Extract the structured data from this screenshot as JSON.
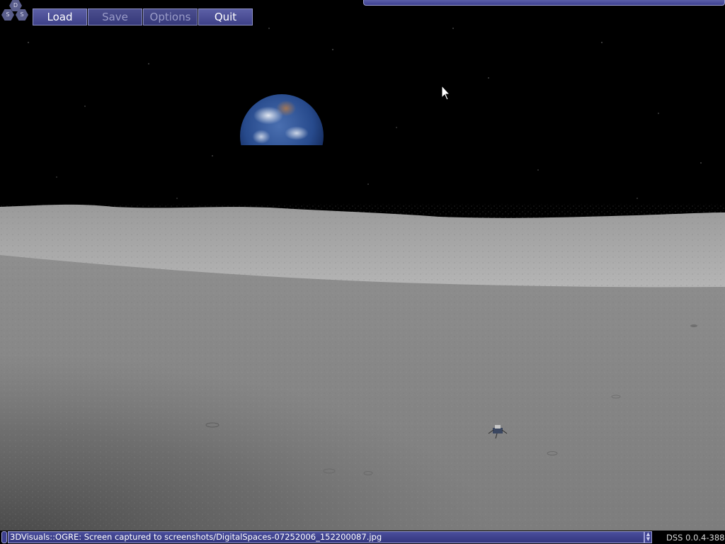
{
  "app": {
    "logo_letters": [
      "D",
      "S",
      "S"
    ]
  },
  "toolbar": {
    "load_label": "Load",
    "save_label": "Save",
    "options_label": "Options",
    "quit_label": "Quit"
  },
  "console": {
    "message": "3DVisuals::OGRE: Screen captured to screenshots/DigitalSpaces-07252006_152200087.jpg"
  },
  "version": "DSS 0.0.4-388",
  "colors": {
    "ui_fill": "#3d4090",
    "ui_border": "#9ea0d4",
    "sky": "#000000",
    "regolith": "#8a8a8a"
  },
  "icons": {
    "logo": "dss-hex-logo",
    "cursor": "arrow-cursor",
    "earth": "earth-planet",
    "lander": "lunar-lander"
  }
}
